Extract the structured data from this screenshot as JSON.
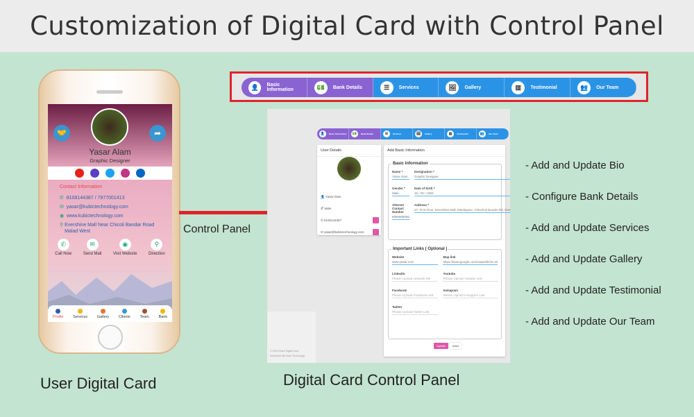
{
  "title": "Customization of  Digital Card with Control Panel",
  "nav_steps": [
    {
      "label": "Basic Information",
      "icon": "user-icon",
      "done": true
    },
    {
      "label": "Bank Details",
      "icon": "money-icon",
      "done": true
    },
    {
      "label": "Services",
      "icon": "list-icon",
      "done": false
    },
    {
      "label": "Gallery",
      "icon": "image-icon",
      "done": false
    },
    {
      "label": "Testimonial",
      "icon": "chart-icon",
      "done": false
    },
    {
      "label": "Our Team",
      "icon": "team-icon",
      "done": false
    }
  ],
  "card": {
    "name": "Yasar Alam",
    "role": "Graphic Designer",
    "contact_heading": "Contact Information",
    "phone": "8108144387 / 7977001413",
    "email": "yasar@kubictechnology.com",
    "website": "www.kubictechnology.com",
    "address": "Evershine Mall Near Chicoli Bandar Road Malad West",
    "actions": [
      "Call Now",
      "Send Mail",
      "Visit Website",
      "Direction"
    ],
    "tabs": [
      "Profile",
      "Services",
      "Gallery",
      "Clients",
      "Team",
      "Bank"
    ],
    "social": [
      {
        "name": "youtube",
        "color": "#e62117"
      },
      {
        "name": "facebook",
        "color": "#5b3fc4"
      },
      {
        "name": "twitter",
        "color": "#1da1f2"
      },
      {
        "name": "instagram",
        "color": "#c13584"
      },
      {
        "name": "linkedin",
        "color": "#0a66c2"
      }
    ]
  },
  "labels": {
    "control_panel": "Control Panel",
    "user_card": "User Digital Card",
    "panel_caption": "Digital Card Control Panel"
  },
  "panel": {
    "user_details": "User Details",
    "user_name": "Yasar Alam",
    "gender": "Male",
    "phone": "8108144387",
    "email": "yasar@kubictechnology.com",
    "form_title": "Add Basic Information",
    "basic_legend": "Basic Information",
    "fields": [
      {
        "label": "Name *",
        "value": "Yasar Alam"
      },
      {
        "label": "Designation *",
        "value": "Graphic Designer"
      },
      {
        "label": "Gender *",
        "value": "Male"
      },
      {
        "label": "Date of birth *",
        "value": "16 / 06 / 1993"
      },
      {
        "label": "Alternet Contact Number",
        "value": "8080808080"
      },
      {
        "label": "Address *",
        "value": "57, First Floor, Evershine Mall, Mindspace, Chincholi Bunder Rd, Ram Nagar, Malad West, Mumbai,"
      }
    ],
    "links_legend": "Important Links ( Optional )",
    "links": [
      {
        "label": "Website",
        "value": "www.yasar.com"
      },
      {
        "label": "Map link",
        "value": "https://www.google.com/maps/dir/19.18"
      },
      {
        "label": "Linkedin",
        "placeholder": "Please Upload Linkedin link"
      },
      {
        "label": "Youtube",
        "placeholder": "Please Upload Youtube Link"
      },
      {
        "label": "Facebook",
        "placeholder": "Please Upload Facebook Link"
      },
      {
        "label": "Instagram",
        "placeholder": "Please Upload Instagram Link"
      },
      {
        "label": "Twitter",
        "placeholder": "Please Upload Twitter Link"
      }
    ],
    "update": "Update",
    "reset": "reset",
    "footer1": "© 2019 Share Digital Card.",
    "footer2": "Developed By Kubic Technology"
  },
  "features": [
    "- Add and Update Bio",
    "- Configure Bank Details",
    "- Add and Update Services",
    "- Add and Update Gallery",
    "- Add and Update Testimonial",
    "- Add and Update Our Team"
  ]
}
